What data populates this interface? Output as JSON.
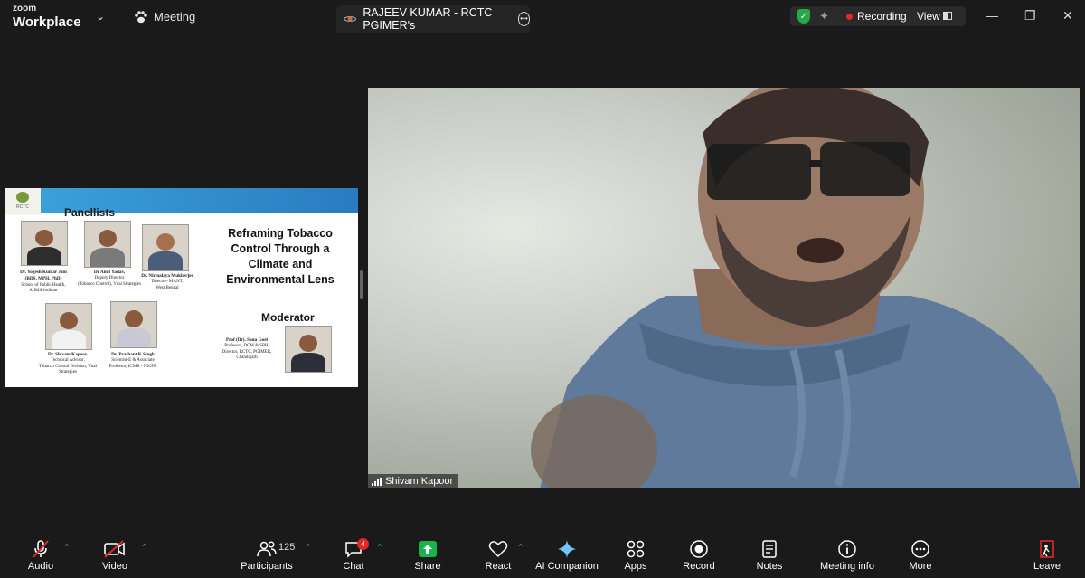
{
  "app": {
    "brand_top": "zoom",
    "brand_main": "Workplace",
    "meeting_label": "Meeting",
    "host_tab_label": "RAJEEV KUMAR - RCTC PGIMER's"
  },
  "status": {
    "recording_label": "Recording",
    "view_label": "View",
    "recording_color": "#e02828",
    "secure_color": "#28a745"
  },
  "share": {
    "panellists_heading": "Panellists",
    "title": "Reframing Tobacco Control Through a Climate and Environmental Lens",
    "moderator_heading": "Moderator",
    "panelists": [
      {
        "name": "Dr. Yogesh Kumar Jain",
        "line2": "(BDS, MPH, PhD)",
        "line3": "School of Public Health,",
        "line4": "AIIMS Jodhpur"
      },
      {
        "name": "Dr Amit Yadav,",
        "line2": "Deputy Director",
        "line3": "(Tobacco Control), Vital Strategies",
        "line4": ""
      },
      {
        "name": "Dr. Nirmalaya Mukherjee",
        "line2": "Director- MANT,",
        "line3": "West Bengal",
        "line4": ""
      },
      {
        "name": "Dr. Shivam Kapoor,",
        "line2": "Technical Advisor,",
        "line3": "Tobacco Control Division, Vital",
        "line4": "Strategies"
      },
      {
        "name": "Dr. Prashant K Singh",
        "line2": "Scientist-E & Associate",
        "line3": "Professor, ICMR - NICPR",
        "line4": ""
      }
    ],
    "moderator": {
      "name": "Prof (Dr). Sonu Goel",
      "line2": "Professor, DCM & SPH,",
      "line3": "Director, RCTC, PGIMER,",
      "line4": "Chandigarh"
    }
  },
  "video": {
    "participant_name": "Shivam Kapoor"
  },
  "toolbar": {
    "audio": "Audio",
    "video": "Video",
    "participants": "Participants",
    "participants_count": "125",
    "chat": "Chat",
    "chat_badge": "4",
    "share": "Share",
    "react": "React",
    "ai_companion": "AI Companion",
    "apps": "Apps",
    "record": "Record",
    "notes": "Notes",
    "meeting_info": "Meeting info",
    "more": "More",
    "leave": "Leave",
    "share_color": "#19b34d",
    "leave_color": "#e02828",
    "muted_color": "#e02828"
  }
}
